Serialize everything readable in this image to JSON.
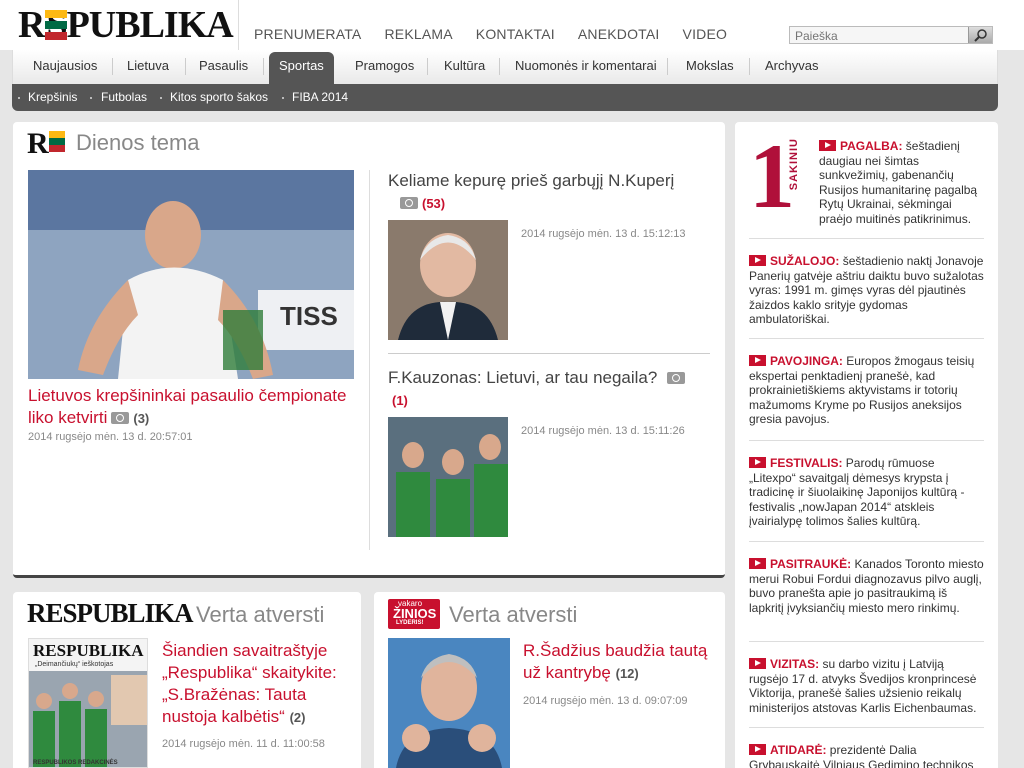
{
  "brand": {
    "logo": "RESPUBLIKA"
  },
  "top_nav": [
    "PRENUMERATA",
    "REKLAMA",
    "KONTAKTAI",
    "ANEKDOTAI",
    "VIDEO"
  ],
  "search": {
    "placeholder": "Paieška"
  },
  "main_nav": [
    "Naujausios",
    "Lietuva",
    "Pasaulis",
    "Sportas",
    "Pramogos",
    "Kultūra",
    "Nuomonės ir komentarai",
    "Mokslas",
    "Archyvas"
  ],
  "main_nav_active": "Sportas",
  "sub_nav": [
    "Krepšinis",
    "Futbolas",
    "Kitos sporto šakos",
    "FIBA 2014"
  ],
  "dienos_tema": {
    "title": "Dienos tema",
    "lead": {
      "headline": "Lietuvos krepšininkai pasaulio čempionate liko ketvirti",
      "count": "(3)",
      "date": "2014 rugsėjo mėn. 13 d. 20:57:01"
    },
    "item1": {
      "headline": "Keliame kepurę prieš garbųjį N.Kuperį",
      "count": "(53)",
      "date": "2014 rugsėjo mėn. 13 d. 15:12:13"
    },
    "item2": {
      "headline": "F.Kauzonas: Lietuvi, ar tau negaila?",
      "count": "(1)",
      "date": "2014 rugsėjo mėn. 13 d. 15:11:26"
    }
  },
  "verta1": {
    "title": "Verta atversti",
    "logo": "RESPUBLIKA",
    "headline": "Šiandien savaitraštyje „Respublika“ skaitykite: „S.Bražėnas: Tauta nustoja kalbėtis“",
    "count": "(2)",
    "date": "2014 rugsėjo mėn. 11 d. 11:00:58",
    "cover_masthead": "RESPUBLIKA",
    "cover_text": "„Deimančiukų“ ieškotojas",
    "cover_footer": "RESPUBLIKOS REDAKCINĖS"
  },
  "verta2": {
    "title": "Verta atversti",
    "logo_top": "vakaro",
    "logo_mid": "ŽINIOS",
    "logo_bottom": "LYDERIS!",
    "headline": "R.Šadžius baudžia tautą už kantrybę",
    "count": "(12)",
    "date": "2014 rugsėjo mėn. 13 d. 09:07:09"
  },
  "one_sentence": {
    "big": "1",
    "label": "SAKINIU",
    "items": [
      {
        "tag": "PAGALBA:",
        "text": "šeštadienį daugiau nei šimtas sunkvežimių, gabenančių Rusijos humanitarinę pagalbą Rytų Ukrainai, sėkmingai praėjo muitinės patikrinimus."
      },
      {
        "tag": "SUŽALOJO:",
        "text": "šeštadienio naktį Jonavoje Panerių gatvėje aštriu daiktu buvo sužalotas vyras: 1991 m. gimęs vyras dėl pjautinės žaizdos kaklo srityje gydomas ambulatoriškai."
      },
      {
        "tag": "PAVOJINGA:",
        "text": "Europos žmogaus teisių ekspertai penktadienį pranešė, kad prokrainietiškiems aktyvistams ir totorių mažumoms Kryme po Rusijos aneksijos gresia pavojus."
      },
      {
        "tag": "FESTIVALIS:",
        "text": "Parodų rūmuose „Litexpo“ savaitgalį dėmesys krypsta į tradicinę ir šiuolaikinę Japonijos kultūrą - festivalis „nowJapan 2014“ atskleis įvairialypę tolimos šalies kultūrą."
      },
      {
        "tag": "PASITRAUKĖ:",
        "text": "Kanados Toronto miesto merui Robui Fordui diagnozavus pilvo auglį, buvo pranešta apie jo pasitraukimą iš lapkritį įvyksiančių miesto mero rinkimų."
      },
      {
        "tag": "VIZITAS:",
        "text": "su darbo vizitu į Latviją rugsėjo 17 d. atvyks Švedijos kronprincesė Viktorija, pranešė šalies užsienio reikalų ministerijos atstovas Karlis Eichenbaumas."
      },
      {
        "tag": "ATIDARĖ:",
        "text": "prezidentė Dalia Grybauskaitė Vilniaus Gedimino technikos"
      }
    ]
  },
  "colors": {
    "accent": "#c8102e",
    "nav_active": "#555555",
    "flag_yellow": "#fdb913",
    "flag_green": "#006a44",
    "flag_red": "#c1272d"
  }
}
